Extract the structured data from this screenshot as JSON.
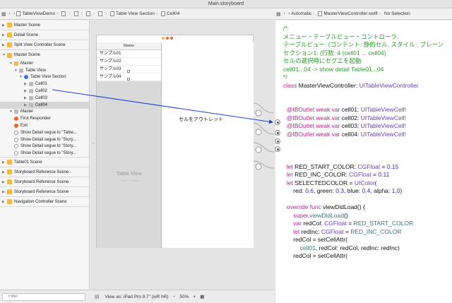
{
  "window": {
    "title": "Main.storyboard"
  },
  "left_toolbar": {
    "breadcrumbs": [
      "TableViewDemo",
      "",
      "",
      "",
      "",
      "Table View Section",
      "Cell04"
    ]
  },
  "right_toolbar": {
    "mode": "Automatic",
    "file": "MasterViewController.swift",
    "selection": "No Selection"
  },
  "outline": {
    "scenes_top": [
      "Master Scene",
      "Detail Scene",
      "Split View Controller Scene"
    ],
    "master_scene": {
      "label": "Master Scene",
      "items": [
        {
          "label": "Master",
          "indent": 1,
          "icon": "yellow"
        },
        {
          "label": "Table View",
          "indent": 2,
          "icon": "gray"
        },
        {
          "label": "Table View Section",
          "indent": 3,
          "icon": "blue"
        },
        {
          "label": "Cell01",
          "indent": 4,
          "icon": "gray"
        },
        {
          "label": "Cell02",
          "indent": 4,
          "icon": "gray"
        },
        {
          "label": "Cell03",
          "indent": 4,
          "icon": "gray"
        },
        {
          "label": "Cell04",
          "indent": 4,
          "icon": "gray",
          "selected": true
        },
        {
          "label": "Master",
          "indent": 1,
          "icon": "gray"
        },
        {
          "label": "First Responder",
          "indent": 1,
          "icon": "orange"
        },
        {
          "label": "Exit",
          "indent": 1,
          "icon": "orange"
        },
        {
          "label": "Show Detail segue to \"Table...",
          "indent": 1,
          "icon": "seg"
        },
        {
          "label": "Show Detail segue to \"Story...",
          "indent": 1,
          "icon": "seg"
        },
        {
          "label": "Show Detail segue to \"Story...",
          "indent": 1,
          "icon": "seg"
        },
        {
          "label": "Show Detail segue to \"Story...",
          "indent": 1,
          "icon": "seg"
        }
      ]
    },
    "scenes_bottom": [
      "Table01 Scene",
      "Storyboard Reference Scene",
      "Storyboard Reference Scene",
      "Storyboard Reference Scene",
      "Navigation Controller Scene"
    ],
    "filter_placeholder": "Filter"
  },
  "canvas": {
    "navbar_title": "Master",
    "cells": [
      "サンプル01",
      "サンプル02",
      "サンプル03",
      "サンプル04"
    ],
    "table_view_label": "Table View",
    "table_view_sublabel": "Static Content",
    "annotation": "セルをアウトレット",
    "view_as": "View as: iPad Pro 9.7\" (wR hR)",
    "zoom": "50%"
  },
  "code_lines": [
    [
      [
        "c-comment",
        "/*:"
      ]
    ],
    [
      [
        "c-comment",
        "メニュー・テーブルビュー・コントローラ."
      ]
    ],
    [
      [
        "c-comment",
        "テーブルビュー: (コンテント: 静的セル, スタイル : プレーン"
      ]
    ],
    [
      [
        "c-comment",
        "セクション1: (行数: 4 (cell01 ... cell04)"
      ]
    ],
    [
      [
        "c-comment",
        "セルの選択時にセグエを起動"
      ]
    ],
    [
      [
        "c-comment",
        "cell01...04 -> show detail Table01...04"
      ]
    ],
    [
      [
        "c-comment",
        "*/"
      ]
    ],
    [
      [
        "c-kw",
        "class "
      ],
      [
        "c-plain",
        "MasterViewController: "
      ],
      [
        "c-type",
        "UITableViewController"
      ]
    ],
    [
      [
        "c-plain",
        ""
      ]
    ],
    [
      [
        "c-plain",
        ""
      ]
    ],
    [
      [
        "c-kw",
        "  @IBOutlet weak var "
      ],
      [
        "c-plain",
        "cell01: "
      ],
      [
        "c-type",
        "UITableViewCell!"
      ]
    ],
    [
      [
        "c-kw",
        "  @IBOutlet weak var "
      ],
      [
        "c-plain",
        "cell02: "
      ],
      [
        "c-type",
        "UITableViewCell!"
      ]
    ],
    [
      [
        "c-kw",
        "  @IBOutlet weak var "
      ],
      [
        "c-plain",
        "cell03: "
      ],
      [
        "c-type",
        "UITableViewCell!"
      ]
    ],
    [
      [
        "c-kw",
        "  @IBOutlet weak var "
      ],
      [
        "c-plain",
        "cell04: "
      ],
      [
        "c-type",
        "UITableViewCell!"
      ]
    ],
    [
      [
        "c-plain",
        ""
      ]
    ],
    [
      [
        "c-plain",
        ""
      ]
    ],
    [
      [
        "c-plain",
        ""
      ]
    ],
    [
      [
        "c-kw",
        "  let "
      ],
      [
        "c-plain",
        "RED_START_COLOR: "
      ],
      [
        "c-type",
        "CGFloat"
      ],
      [
        "c-plain",
        " = "
      ],
      [
        "c-num",
        "0.15"
      ]
    ],
    [
      [
        "c-kw",
        "  let "
      ],
      [
        "c-plain",
        "RED_INC_COLOR: "
      ],
      [
        "c-type",
        "CGFloat"
      ],
      [
        "c-plain",
        " = "
      ],
      [
        "c-num",
        "0.11"
      ]
    ],
    [
      [
        "c-kw",
        "  let "
      ],
      [
        "c-plain",
        "SELECTEDCOLOR = "
      ],
      [
        "c-type",
        "UIColor"
      ],
      [
        "c-plain",
        "("
      ]
    ],
    [
      [
        "c-plain",
        "      red: "
      ],
      [
        "c-num",
        "0.6"
      ],
      [
        "c-plain",
        ", green: "
      ],
      [
        "c-num",
        "0.3"
      ],
      [
        "c-plain",
        ", blue: "
      ],
      [
        "c-num",
        "0.4"
      ],
      [
        "c-plain",
        ", alpha: "
      ],
      [
        "c-num",
        "1.0"
      ],
      [
        "c-plain",
        ")"
      ]
    ],
    [
      [
        "c-plain",
        ""
      ]
    ],
    [
      [
        "c-kw",
        "  override func "
      ],
      [
        "c-plain",
        "viewDidLoad() {"
      ]
    ],
    [
      [
        "c-kw",
        "      super"
      ],
      [
        "c-plain",
        "."
      ],
      [
        "c-func",
        "viewDidLoad"
      ],
      [
        "c-plain",
        "()"
      ]
    ],
    [
      [
        "c-kw",
        "      var "
      ],
      [
        "c-plain",
        "redCol: "
      ],
      [
        "c-type",
        "CGFloat"
      ],
      [
        "c-plain",
        " = "
      ],
      [
        "c-func",
        "RED_START_COLOR"
      ]
    ],
    [
      [
        "c-kw",
        "      let "
      ],
      [
        "c-plain",
        "redInc: "
      ],
      [
        "c-type",
        "CGFloat"
      ],
      [
        "c-plain",
        " = "
      ],
      [
        "c-func",
        "RED_INC_COLOR"
      ]
    ],
    [
      [
        "c-plain",
        "      redCol = setCellAttr("
      ]
    ],
    [
      [
        "c-func",
        "          cell01"
      ],
      [
        "c-plain",
        ", redCol: redCol, redInc: redInc)"
      ]
    ],
    [
      [
        "c-plain",
        "      redCol = setCellAttr("
      ]
    ]
  ]
}
